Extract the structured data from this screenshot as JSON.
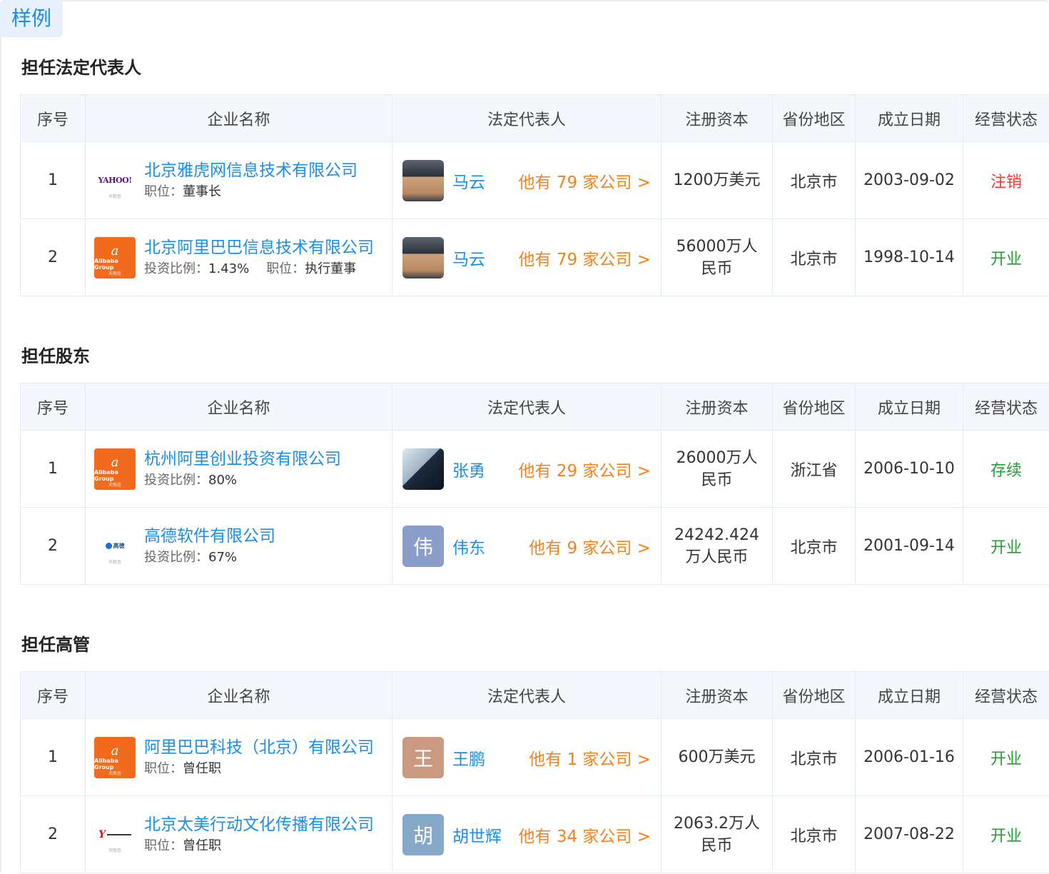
{
  "sample_label": "样例",
  "columns": [
    "序号",
    "企业名称",
    "法定代表人",
    "注册资本",
    "省份地区",
    "成立日期",
    "经营状态"
  ],
  "watermark_text": "天眼查",
  "sections": [
    {
      "title": "担任法定代表人",
      "rows": [
        {
          "index": "1",
          "logo": {
            "kind": "yahoo",
            "text": "YAHOO!"
          },
          "company": "北京雅虎网信息技术有限公司",
          "meta": [
            {
              "label": "职位：",
              "value": "董事长"
            }
          ],
          "person": "马云",
          "avatar": {
            "kind": "photo",
            "char": ""
          },
          "link": "他有 79 家公司 >",
          "capital": "1200万美元",
          "region": "北京市",
          "date": "2003-09-02",
          "status": "注销",
          "status_color": "#f23b2c"
        },
        {
          "index": "2",
          "logo": {
            "kind": "alibaba",
            "text": "Alibaba Group"
          },
          "company": "北京阿里巴巴信息技术有限公司",
          "meta": [
            {
              "label": "投资比例：",
              "value": "1.43%"
            },
            {
              "label": "职位：",
              "value": "执行董事"
            }
          ],
          "person": "马云",
          "avatar": {
            "kind": "photo",
            "char": ""
          },
          "link": "他有 79 家公司 >",
          "capital": "56000万人民币",
          "region": "北京市",
          "date": "1998-10-14",
          "status": "开业",
          "status_color": "#1aa32a"
        }
      ]
    },
    {
      "title": "担任股东",
      "rows": [
        {
          "index": "1",
          "logo": {
            "kind": "alibaba",
            "text": "Alibaba Group"
          },
          "company": "杭州阿里创业投资有限公司",
          "meta": [
            {
              "label": "投资比例：",
              "value": "80%"
            }
          ],
          "person": "张勇",
          "avatar": {
            "kind": "photo2",
            "char": ""
          },
          "link": "他有 29 家公司 >",
          "capital": "26000万人民币",
          "region": "浙江省",
          "date": "2006-10-10",
          "status": "存续",
          "status_color": "#1aa32a"
        },
        {
          "index": "2",
          "logo": {
            "kind": "gaode",
            "text": "高德"
          },
          "company": "高德软件有限公司",
          "meta": [
            {
              "label": "投资比例：",
              "value": "67%"
            }
          ],
          "person": "伟东",
          "avatar": {
            "kind": "letter",
            "char": "伟",
            "color": "#8b9dc9"
          },
          "link": "他有 9 家公司 >",
          "capital": "24242.424万人民币",
          "region": "北京市",
          "date": "2001-09-14",
          "status": "开业",
          "status_color": "#1aa32a"
        }
      ]
    },
    {
      "title": "担任高管",
      "rows": [
        {
          "index": "1",
          "logo": {
            "kind": "alibaba",
            "text": "Alibaba Group"
          },
          "company": "阿里巴巴科技（北京）有限公司",
          "meta": [
            {
              "label": "职位：",
              "value": "曾任职"
            }
          ],
          "person": "王鹏",
          "avatar": {
            "kind": "letter",
            "char": "王",
            "color": "#c99a80"
          },
          "link": "他有 1 家公司 >",
          "capital": "600万美元",
          "region": "北京市",
          "date": "2006-01-16",
          "status": "开业",
          "status_color": "#1aa32a"
        },
        {
          "index": "2",
          "logo": {
            "kind": "taimei",
            "text": "Y"
          },
          "company": "北京太美行动文化传播有限公司",
          "meta": [
            {
              "label": "职位：",
              "value": "曾任职"
            }
          ],
          "person": "胡世辉",
          "avatar": {
            "kind": "letter",
            "char": "胡",
            "color": "#86a9c9"
          },
          "link": "他有 34 家公司 >",
          "capital": "2063.2万人民币",
          "region": "北京市",
          "date": "2007-08-22",
          "status": "开业",
          "status_color": "#1aa32a"
        }
      ]
    }
  ]
}
